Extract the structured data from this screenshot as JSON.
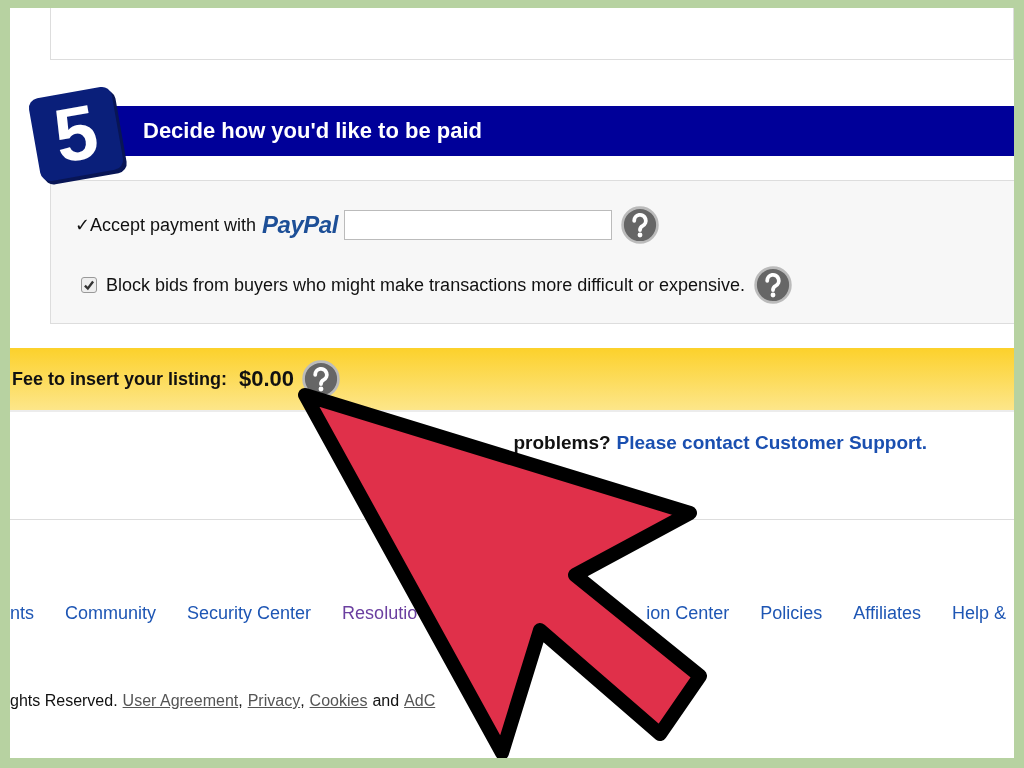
{
  "step": {
    "number": "5",
    "title": "Decide how you'd like to be paid"
  },
  "payment_options": [
    {
      "kind": "paypal",
      "check_mark": "✓",
      "label": "Accept payment with",
      "logo": "PayPal"
    },
    {
      "kind": "checkbox",
      "label": "Block bids from buyers who might make transactions more difficult or expensive.",
      "checked": true
    }
  ],
  "fee": {
    "label": "Fee to insert your listing:",
    "amount": "$0.00"
  },
  "support": {
    "text": "problems?",
    "link": "Please contact Customer Support."
  },
  "footer_links": [
    {
      "label": "nts",
      "visited": false
    },
    {
      "label": "Community",
      "visited": false
    },
    {
      "label": "Security Center",
      "visited": false
    },
    {
      "label": "Resolutio",
      "visited": true
    },
    {
      "label": "ion Center",
      "visited": false
    },
    {
      "label": "Policies",
      "visited": false
    },
    {
      "label": "Affiliates",
      "visited": false
    },
    {
      "label": "Help &",
      "visited": false
    }
  ],
  "legal": [
    {
      "kind": "text",
      "text": "ghts Reserved."
    },
    {
      "kind": "link",
      "text": "User Agreement"
    },
    {
      "kind": "text",
      "text": ","
    },
    {
      "kind": "link",
      "text": "Privacy"
    },
    {
      "kind": "text",
      "text": ","
    },
    {
      "kind": "link",
      "text": "Cookies"
    },
    {
      "kind": "text",
      "text": "and"
    },
    {
      "kind": "link",
      "text": "AdC"
    }
  ]
}
